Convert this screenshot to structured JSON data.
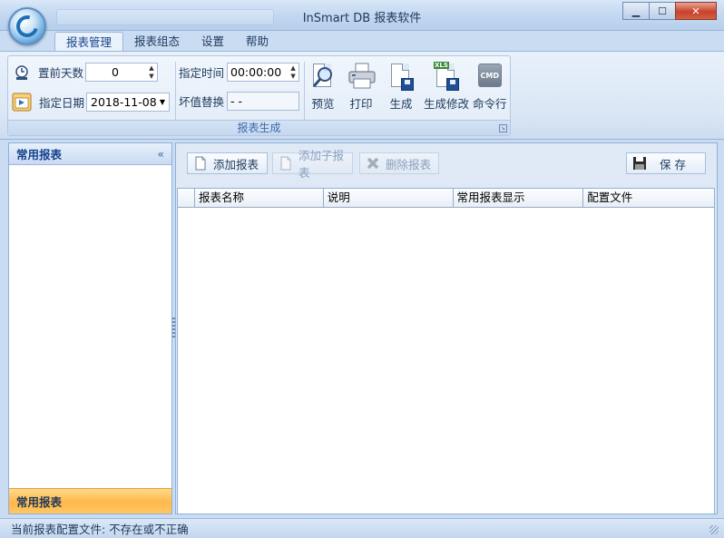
{
  "window": {
    "title": "InSmart DB 报表软件",
    "minimize_glyph": "▁",
    "maximize_glyph": "☐",
    "close_glyph": "✕"
  },
  "ribbon": {
    "tabs": [
      {
        "label": "报表管理",
        "active": true
      },
      {
        "label": "报表组态",
        "active": false
      },
      {
        "label": "设置",
        "active": false
      },
      {
        "label": "帮助",
        "active": false
      }
    ],
    "group_label": "报表生成",
    "days_before_label": "置前天数",
    "days_before_value": "0",
    "date_label": "指定日期",
    "date_value": "2018-11-08",
    "time_label": "指定时间",
    "time_value": "00:00:00",
    "bad_value_label": "坏值替换",
    "bad_value_value": "- -",
    "buttons": {
      "preview": "预览",
      "print": "打印",
      "generate": "生成",
      "generate_modify": "生成修改",
      "command": "命令行"
    },
    "xls_badge": "XLS",
    "cmd_badge": "CMD"
  },
  "left_pane": {
    "header": "常用报表",
    "collapse_glyph": "«",
    "footer": "常用报表"
  },
  "toolbar": {
    "add_report": "添加报表",
    "add_subreport": "添加子报表",
    "delete_report": "删除报表",
    "save": "保  存"
  },
  "table": {
    "columns": [
      "报表名称",
      "说明",
      "常用报表显示",
      "配置文件"
    ],
    "rows": []
  },
  "status": {
    "text": "当前报表配置文件: 不存在或不正确"
  },
  "colors": {
    "accent": "#15428b",
    "ribbon_bg": "#dbe7f6",
    "footer_highlight": "#ffb84a"
  }
}
